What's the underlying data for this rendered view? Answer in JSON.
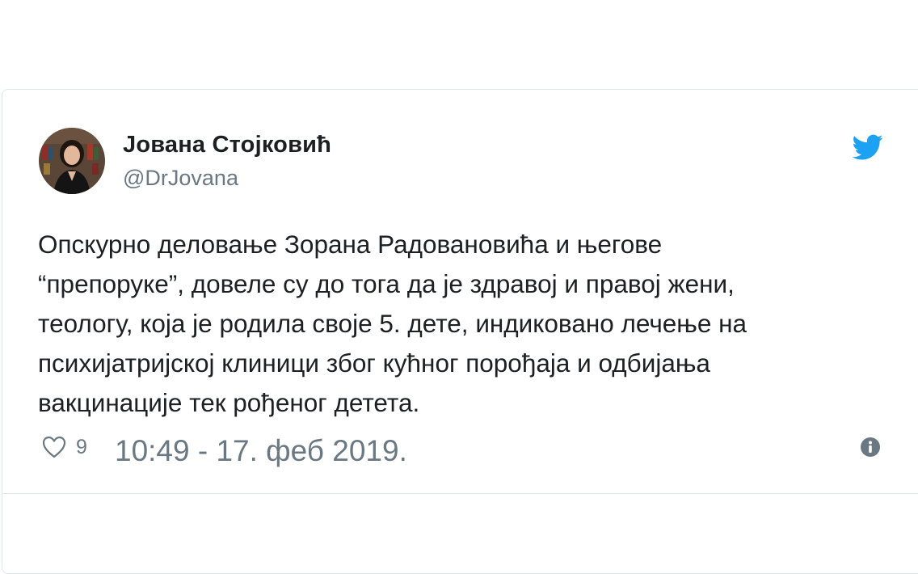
{
  "tweet": {
    "author": {
      "name": "Јована Стојковић",
      "handle": "@DrJovana"
    },
    "text_lines": [
      "Опскурно деловање Зорана Радовановића и његове",
      "“препоруке”, довеле су до тога да је здравој и правој жени,",
      "теологу, која је родила своје 5. дете, индиковано лечење на",
      "психијатријској клиници због кућног порођаја и одбијања",
      "вакцинације тек рођеног детета."
    ],
    "likes": "9",
    "timestamp": "10:49 - 17. феб 2019."
  },
  "icons": {
    "brand": "twitter-bird-icon",
    "like": "heart-icon",
    "info": "info-icon"
  },
  "colors": {
    "brand": "#1da1f2",
    "text": "#1c2022",
    "secondary": "#697882",
    "border": "#e1e8ed"
  }
}
